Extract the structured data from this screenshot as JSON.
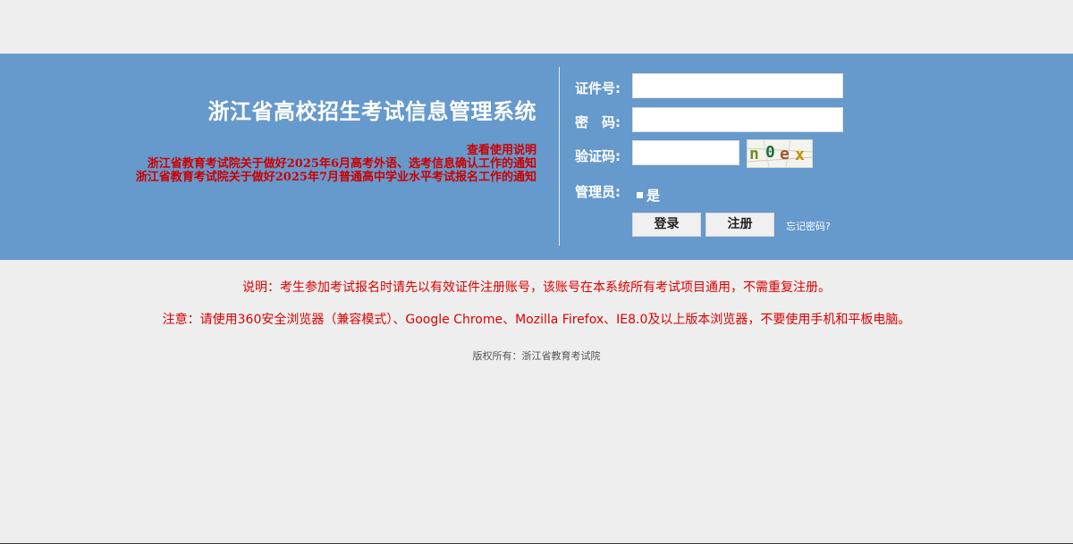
{
  "header": {
    "title": "浙江省高校招生考试信息管理系统",
    "links": [
      "查看使用说明",
      "浙江省教育考试院关于做好2025年6月高考外语、选考信息确认工作的通知",
      "浙江省教育考试院关于做好2025年7月普通高中学业水平考试报名工作的通知"
    ]
  },
  "login": {
    "id_label": "证件号:",
    "id_value": "",
    "password_label": "密　码:",
    "password_value": "",
    "captcha_label": "验证码:",
    "captcha_value": "",
    "captcha_text": "n0ex",
    "admin_label": "管理员:",
    "admin_option": "是",
    "login_button": "登录",
    "register_button": "注册",
    "forgot_link": "忘记密码?"
  },
  "footer": {
    "note1": "说明：考生参加考试报名时请先以有效证件注册账号，该账号在本系统所有考试项目通用，不需重复注册。",
    "note2": "注意：请使用360安全浏览器（兼容模式）、Google Chrome、Mozilla Firefox、IE8.0及以上版本浏览器，不要使用手机和平板电脑。",
    "copyright": "版权所有：浙江省教育考试院"
  },
  "colors": {
    "banner": "#6699cc",
    "page_background": "#eeeeee",
    "notice_red": "#cc0000"
  }
}
